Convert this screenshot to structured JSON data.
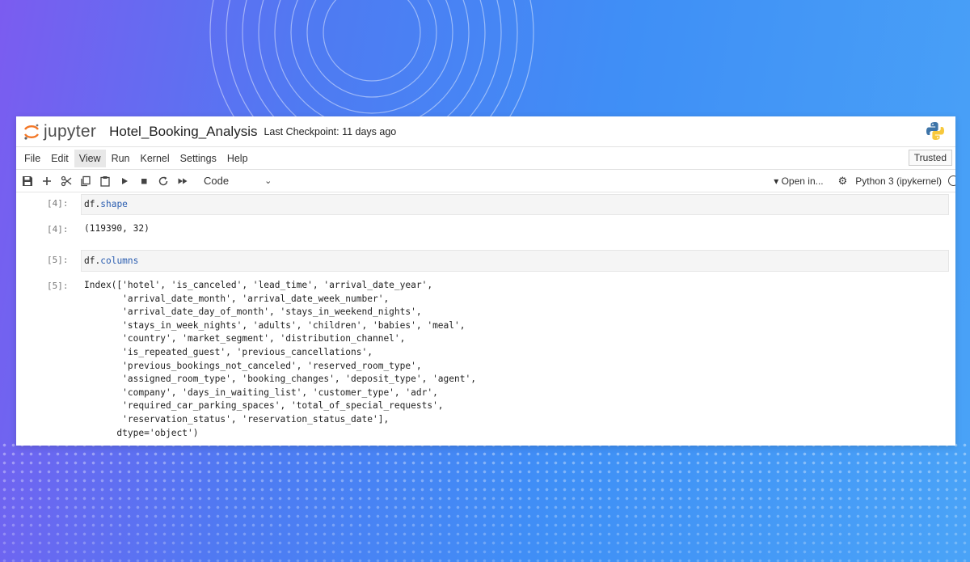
{
  "header": {
    "logo_text": "jupyter",
    "notebook_name": "Hotel_Booking_Analysis",
    "checkpoint": "Last Checkpoint: 11 days ago"
  },
  "menu": {
    "items": [
      "File",
      "Edit",
      "View",
      "Run",
      "Kernel",
      "Settings",
      "Help"
    ],
    "trusted": "Trusted"
  },
  "toolbar": {
    "cell_type": "Code",
    "open_in": "Open in...",
    "kernel": "Python 3 (ipykernel)",
    "icons": [
      "save-icon",
      "add-cell-icon",
      "cut-icon",
      "copy-icon",
      "paste-icon",
      "run-icon",
      "stop-icon",
      "restart-icon",
      "fast-forward-icon"
    ]
  },
  "cells": [
    {
      "prompt": "[4]:",
      "var": "df",
      "attr": "shape"
    },
    {
      "prompt": "[4]:",
      "output": "(119390, 32)"
    },
    {
      "prompt": "[5]:",
      "var": "df",
      "attr": "columns"
    },
    {
      "prompt": "[5]:",
      "output": "Index(['hotel', 'is_canceled', 'lead_time', 'arrival_date_year',\n       'arrival_date_month', 'arrival_date_week_number',\n       'arrival_date_day_of_month', 'stays_in_weekend_nights',\n       'stays_in_week_nights', 'adults', 'children', 'babies', 'meal',\n       'country', 'market_segment', 'distribution_channel',\n       'is_repeated_guest', 'previous_cancellations',\n       'previous_bookings_not_canceled', 'reserved_room_type',\n       'assigned_room_type', 'booking_changes', 'deposit_type', 'agent',\n       'company', 'days_in_waiting_list', 'customer_type', 'adr',\n       'required_car_parking_spaces', 'total_of_special_requests',\n       'reservation_status', 'reservation_status_date'],\n      dtype='object')"
    }
  ],
  "colors": {
    "jupyter_orange": "#f37726",
    "code_attr": "#2a5db0",
    "background_start": "#7b5cf0",
    "background_end": "#4aa3f7"
  }
}
